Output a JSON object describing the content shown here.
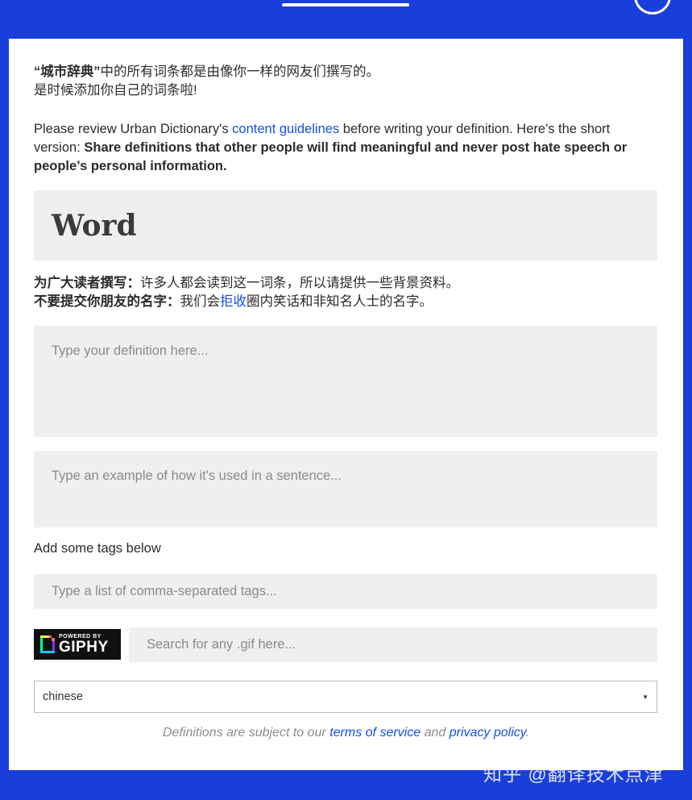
{
  "header": {
    "tab_indicator": "",
    "profile": ""
  },
  "intro": {
    "line1_bold": "“城市辞典”",
    "line1_rest": "中的所有词条都是由像你一样的网友们撰写的。",
    "line2": "是时候添加你自己的词条啦!"
  },
  "review": {
    "prefix": "Please review Urban Dictionary's ",
    "link": "content guidelines",
    "suffix": " before writing your definition. Here's the short version: ",
    "bold": "Share definitions that other people will find meaningful and never post hate speech or people’s personal information."
  },
  "word": {
    "placeholder": "Word"
  },
  "guidance": {
    "line1_bold": "为广大读者撰写：",
    "line1_rest": "许多人都会读到这一词条，所以请提供一些背景资料。",
    "line2_bold": "不要提交你朋友的名字：",
    "line2_pre": "我们会",
    "line2_link": "拒收",
    "line2_post": "圈内笑话和非知名人士的名字。"
  },
  "definition": {
    "placeholder": "Type your definition here..."
  },
  "example": {
    "placeholder": "Type an example of how it's used in a sentence..."
  },
  "tags": {
    "label": "Add some tags below",
    "placeholder": "Type a list of comma-separated tags..."
  },
  "giphy": {
    "powered_by": "POWERED BY",
    "brand": "GIPHY",
    "search_placeholder": "Search for any .gif here..."
  },
  "language": {
    "selected": "chinese"
  },
  "footer": {
    "prefix": "Definitions are subject to our ",
    "terms": "terms of service",
    "middle": " and ",
    "privacy": "privacy policy",
    "suffix": "."
  },
  "watermark": "知乎 @翻译技术点津",
  "colors": {
    "background": "#1a3edb",
    "link": "#134fe6",
    "field": "#efefef"
  }
}
